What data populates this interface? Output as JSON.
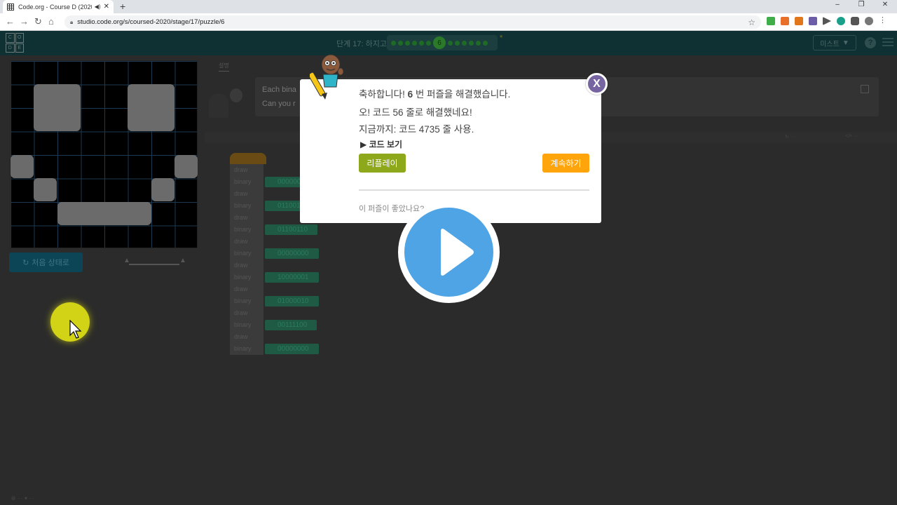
{
  "browser": {
    "tab_title": "Code.org - Course D (2020",
    "tab_audio_icon": "speaker-icon",
    "new_tab": "+",
    "url": "studio.code.org/s/coursed-2020/stage/17/puzzle/6",
    "window_controls": [
      "–",
      "❐",
      "✕"
    ]
  },
  "site_header": {
    "logo_letters": [
      "C",
      "O",
      "D",
      "E"
    ],
    "stage_label": "단계 17: 하지고 2",
    "current_puzzle": "6",
    "dots_before": 6,
    "dots_after": 6,
    "menu_button": "미스트",
    "help": "?"
  },
  "workspace": {
    "instructions_tab": "설명",
    "instruction_line1": "Each bina",
    "instruction_line2": "Can you r",
    "reset_button": "처음 상태로",
    "blocks": [
      {
        "label": "draw"
      },
      {
        "label": "binary",
        "value": "00000000"
      },
      {
        "label": "draw"
      },
      {
        "label": "binary",
        "value": "01100110"
      },
      {
        "label": "draw"
      },
      {
        "label": "binary",
        "value": "01100110"
      },
      {
        "label": "draw"
      },
      {
        "label": "binary",
        "value": "00000000"
      },
      {
        "label": "draw"
      },
      {
        "label": "binary",
        "value": "10000001"
      },
      {
        "label": "draw"
      },
      {
        "label": "binary",
        "value": "01000010"
      },
      {
        "label": "draw"
      },
      {
        "label": "binary",
        "value": "00111100"
      },
      {
        "label": "draw"
      },
      {
        "label": "binary",
        "value": "00000000"
      }
    ]
  },
  "dialog": {
    "line1_prefix": "축하합니다! ",
    "line1_number": "6",
    "line1_suffix": " 번 퍼즐을 해결했습니다.",
    "line2": "오! 코드 56 줄로 해결했네요!",
    "line3": "지금까지: 코드 4735 줄 사용.",
    "show_code": "▶ 코드 보기",
    "replay_button": "리플레이",
    "continue_button": "계속하기",
    "feedback": "이 퍼즐이 좋았나요?",
    "close_button": "X"
  },
  "colors": {
    "replay": "#8ea81b",
    "continue": "#ffa40a",
    "close": "#7665a0",
    "play": "#4ea4e5",
    "cursor_highlight": "#f0f014"
  }
}
